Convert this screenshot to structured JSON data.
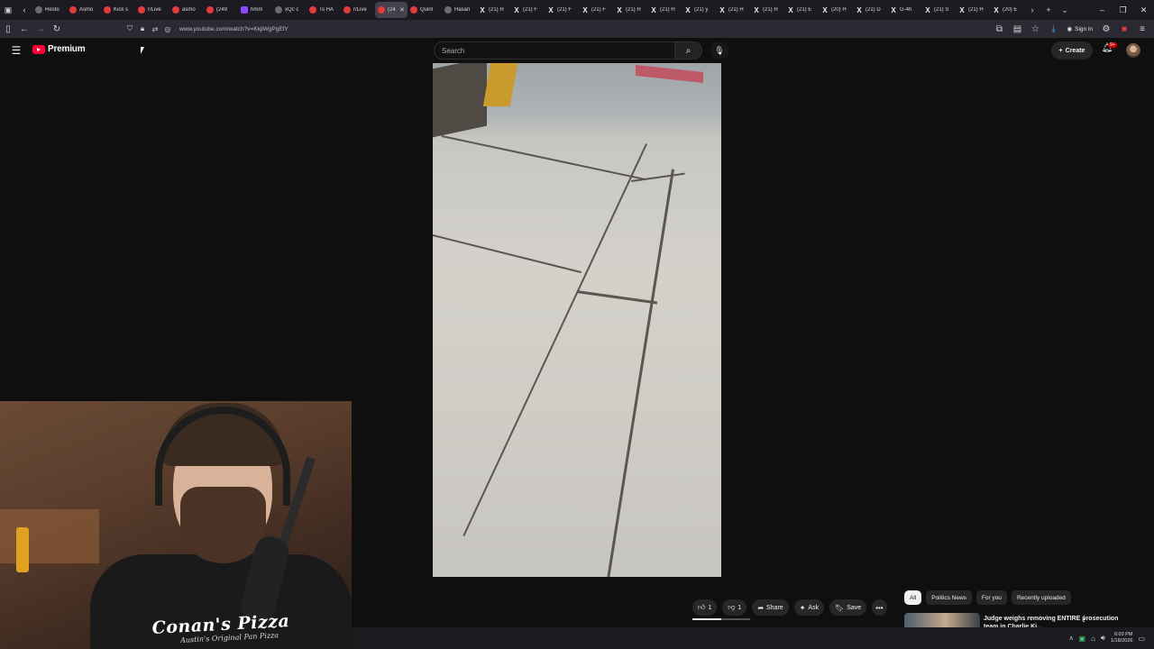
{
  "browser": {
    "tabs": [
      {
        "favicon": "globe",
        "label": "Resto"
      },
      {
        "favicon": "red",
        "label": "Asmo"
      },
      {
        "favicon": "red",
        "label": "Kick s"
      },
      {
        "favicon": "red",
        "label": "r/Live"
      },
      {
        "favicon": "red",
        "label": "asmo"
      },
      {
        "favicon": "red",
        "label": "(249"
      },
      {
        "favicon": "twitch",
        "label": "hmm"
      },
      {
        "favicon": "globe",
        "label": "xQc c"
      },
      {
        "favicon": "red",
        "label": "Ts HA"
      },
      {
        "favicon": "red",
        "label": "r/Live"
      },
      {
        "favicon": "red",
        "label": "(24",
        "active": true
      },
      {
        "favicon": "red",
        "label": "Quinl"
      },
      {
        "favicon": "globe",
        "label": "Hasan"
      },
      {
        "favicon": "x",
        "label": "(21) H"
      },
      {
        "favicon": "x",
        "label": "(21) F"
      },
      {
        "favicon": "x",
        "label": "(21) F"
      },
      {
        "favicon": "x",
        "label": "(21) F"
      },
      {
        "favicon": "x",
        "label": "(21) H"
      },
      {
        "favicon": "x",
        "label": "(21) H"
      },
      {
        "favicon": "x",
        "label": "(21) y"
      },
      {
        "favicon": "x",
        "label": "(21) H"
      },
      {
        "favicon": "x",
        "label": "(21) H"
      },
      {
        "favicon": "x",
        "label": "(21) E"
      },
      {
        "favicon": "x",
        "label": "(20) H"
      },
      {
        "favicon": "x",
        "label": "(21) D"
      },
      {
        "favicon": "x",
        "label": "G-4h"
      },
      {
        "favicon": "x",
        "label": "(21) S"
      },
      {
        "favicon": "x",
        "label": "(21) H"
      },
      {
        "favicon": "x",
        "label": "(20) E"
      }
    ],
    "url": "www.youtube.com/watch?v=KkjiWgPgEfY",
    "signin_label": "Sign in"
  },
  "youtube": {
    "logo_text": "Premium",
    "search_placeholder": "Search",
    "create_label": "Create",
    "bell_badge": "9+",
    "actions": {
      "like_count": "1",
      "dislike_count": "1",
      "share_label": "Share",
      "ask_label": "Ask",
      "save_label": "Save"
    },
    "chips": [
      "All",
      "Politics News",
      "For you",
      "Recently uploaded"
    ],
    "recommendation": {
      "title": "Judge weighs removing ENTIRE prosecution team in Charlie Ki..."
    }
  },
  "webcam": {
    "shirt_logo": "Conan's Pizza",
    "shirt_sub": "Austin's Original Pan Pizza"
  },
  "taskbar": {
    "time": "6:03 PM",
    "date": "1/18/2026"
  },
  "colors": {
    "youtube_red": "#ff0033",
    "page_bg": "#0f0f0f",
    "browser_chrome": "#1c1b22"
  }
}
